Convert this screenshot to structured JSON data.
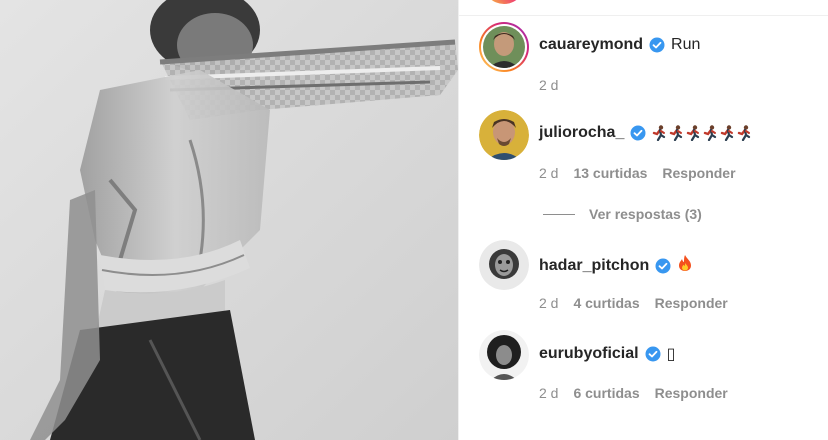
{
  "comments": [
    {
      "username": "cauareymond",
      "text": "Run",
      "time": "2 d",
      "likes": "",
      "reply": "",
      "verified": true
    },
    {
      "username": "juliorocha_",
      "text": "",
      "emoji_run_count": 6,
      "time": "2 d",
      "likes": "13 curtidas",
      "reply": "Responder",
      "verified": true
    },
    {
      "username": "hadar_pitchon",
      "text": "",
      "emoji": "fire-icon",
      "time": "2 d",
      "likes": "4 curtidas",
      "reply": "Responder",
      "verified": true
    },
    {
      "username": "eurubyoficial",
      "text": "▯",
      "time": "2 d",
      "likes": "6 curtidas",
      "reply": "Responder",
      "verified": true
    }
  ],
  "view_replies": "Ver respostas (3)",
  "colors": {
    "verified_blue": "#3897f0",
    "meta_gray": "#8e8e8e",
    "text": "#262626"
  }
}
